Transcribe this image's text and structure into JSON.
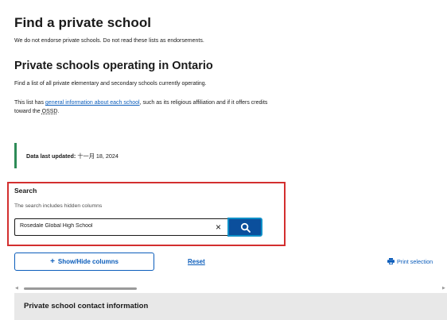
{
  "page": {
    "title": "Find a private school",
    "disclaimer": "We do not endorse private schools. Do not read these lists as endorsements.",
    "section_heading": "Private schools operating in Ontario",
    "intro": "Find a list of all private elementary and secondary schools currently operating.",
    "list_text_before": "This list has ",
    "list_link": "general information about each school",
    "list_text_after": ", such as its religious affiliation and if it offers credits",
    "list_text_line2_before": "toward the ",
    "list_abbr": "OSSD",
    "list_text_line2_after": "."
  },
  "callout": {
    "label": "Data last updated:",
    "value": "十一月 18, 2024",
    "accent_color": "#2e8b57"
  },
  "search": {
    "label": "Search",
    "hint": "The search includes hidden columns",
    "value": "Rosedale Global High School",
    "clear_icon": "×",
    "button_icon": "search-icon",
    "highlight_color": "#d32f2f"
  },
  "controls": {
    "show_hide_plus": "+",
    "show_hide_label": "Show/Hide columns",
    "reset_label": "Reset",
    "print_label": "Print selection"
  },
  "table": {
    "header": "Private school contact information"
  }
}
